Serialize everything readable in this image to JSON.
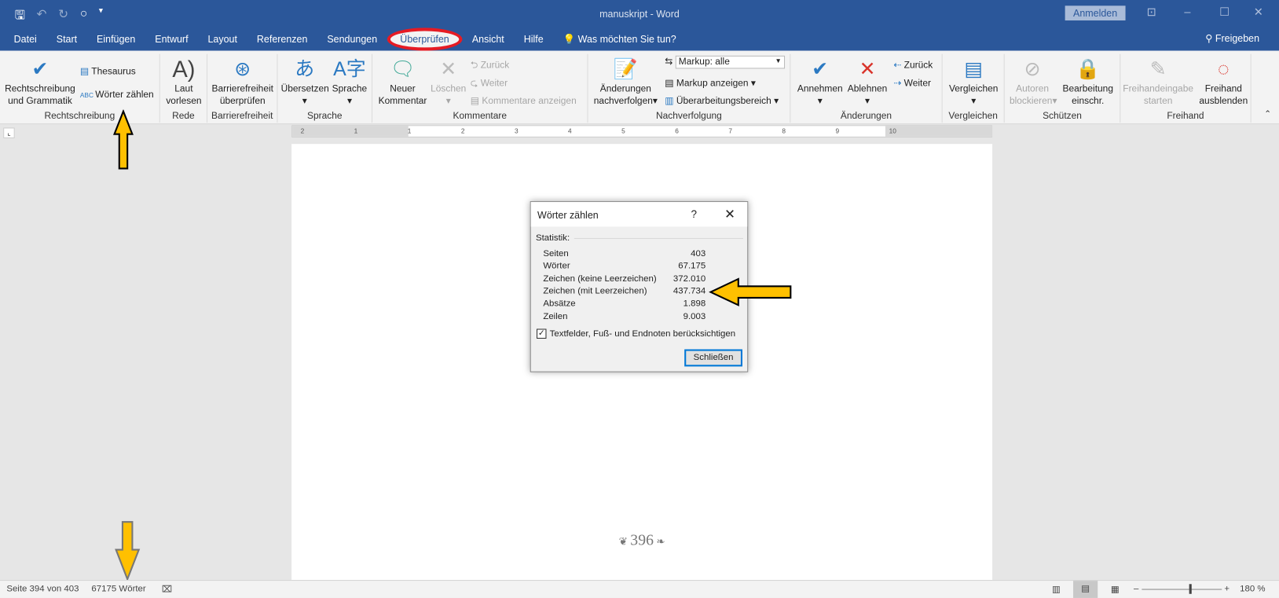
{
  "window": {
    "title": "manuskript  -  Word",
    "signin": "Anmelden",
    "share": "Freigeben"
  },
  "tabs": [
    "Datei",
    "Start",
    "Einfügen",
    "Entwurf",
    "Layout",
    "Referenzen",
    "Sendungen",
    "Überprüfen",
    "Ansicht",
    "Hilfe"
  ],
  "tell_me": "Was möchten Sie tun?",
  "ribbon": {
    "rechtschreibung": {
      "spell": "Rechtschreibung",
      "spell2": "und Grammatik",
      "thesaurus": "Thesaurus",
      "wordcount": "Wörter zählen",
      "label": "Rechtschreibung"
    },
    "rede": {
      "read": "Laut",
      "read2": "vorlesen",
      "label": "Rede"
    },
    "barriere": {
      "check": "Barrierefreiheit",
      "check2": "überprüfen",
      "label": "Barrierefreiheit"
    },
    "sprache": {
      "translate": "Übersetzen",
      "language": "Sprache",
      "label": "Sprache"
    },
    "kommentare": {
      "new": "Neuer",
      "new2": "Kommentar",
      "delete": "Löschen",
      "prev": "Zurück",
      "next": "Weiter",
      "show": "Kommentare anzeigen",
      "label": "Kommentare"
    },
    "nachverfolgung": {
      "track": "Änderungen",
      "track2": "nachverfolgen",
      "markup_select": "Markup: alle",
      "show_markup": "Markup anzeigen",
      "pane": "Überarbeitungsbereich",
      "label": "Nachverfolgung"
    },
    "aenderungen": {
      "accept": "Annehmen",
      "reject": "Ablehnen",
      "prev": "Zurück",
      "next": "Weiter",
      "label": "Änderungen"
    },
    "vergleichen": {
      "compare": "Vergleichen",
      "label": "Vergleichen"
    },
    "schuetzen": {
      "block": "Autoren",
      "block2": "blockieren",
      "restrict": "Bearbeitung",
      "restrict2": "einschr.",
      "label": "Schützen"
    },
    "freihand": {
      "start": "Freihandeingabe",
      "start2": "starten",
      "hide": "Freihand",
      "hide2": "ausblenden",
      "label": "Freihand"
    }
  },
  "ruler_ticks": [
    "2",
    "1",
    "1",
    "2",
    "3",
    "4",
    "5",
    "6",
    "7",
    "8",
    "9",
    "10"
  ],
  "page_number": "396",
  "dialog": {
    "title": "Wörter zählen",
    "help": "?",
    "section": "Statistik:",
    "rows": [
      {
        "label": "Seiten",
        "value": "403"
      },
      {
        "label": "Wörter",
        "value": "67.175"
      },
      {
        "label": "Zeichen (keine Leerzeichen)",
        "value": "372.010"
      },
      {
        "label": "Zeichen (mit Leerzeichen)",
        "value": "437.734"
      },
      {
        "label": "Absätze",
        "value": "1.898"
      },
      {
        "label": "Zeilen",
        "value": "9.003"
      }
    ],
    "checkbox": "Textfelder, Fuß- und Endnoten berücksichtigen",
    "checked": true,
    "close": "Schließen"
  },
  "status": {
    "page": "Seite 394 von 403",
    "words": "67175 Wörter",
    "zoom": "180 %"
  },
  "colors": {
    "accent": "#2b579a",
    "highlight_ring": "#e61b24",
    "arrow": "#ffc000"
  }
}
